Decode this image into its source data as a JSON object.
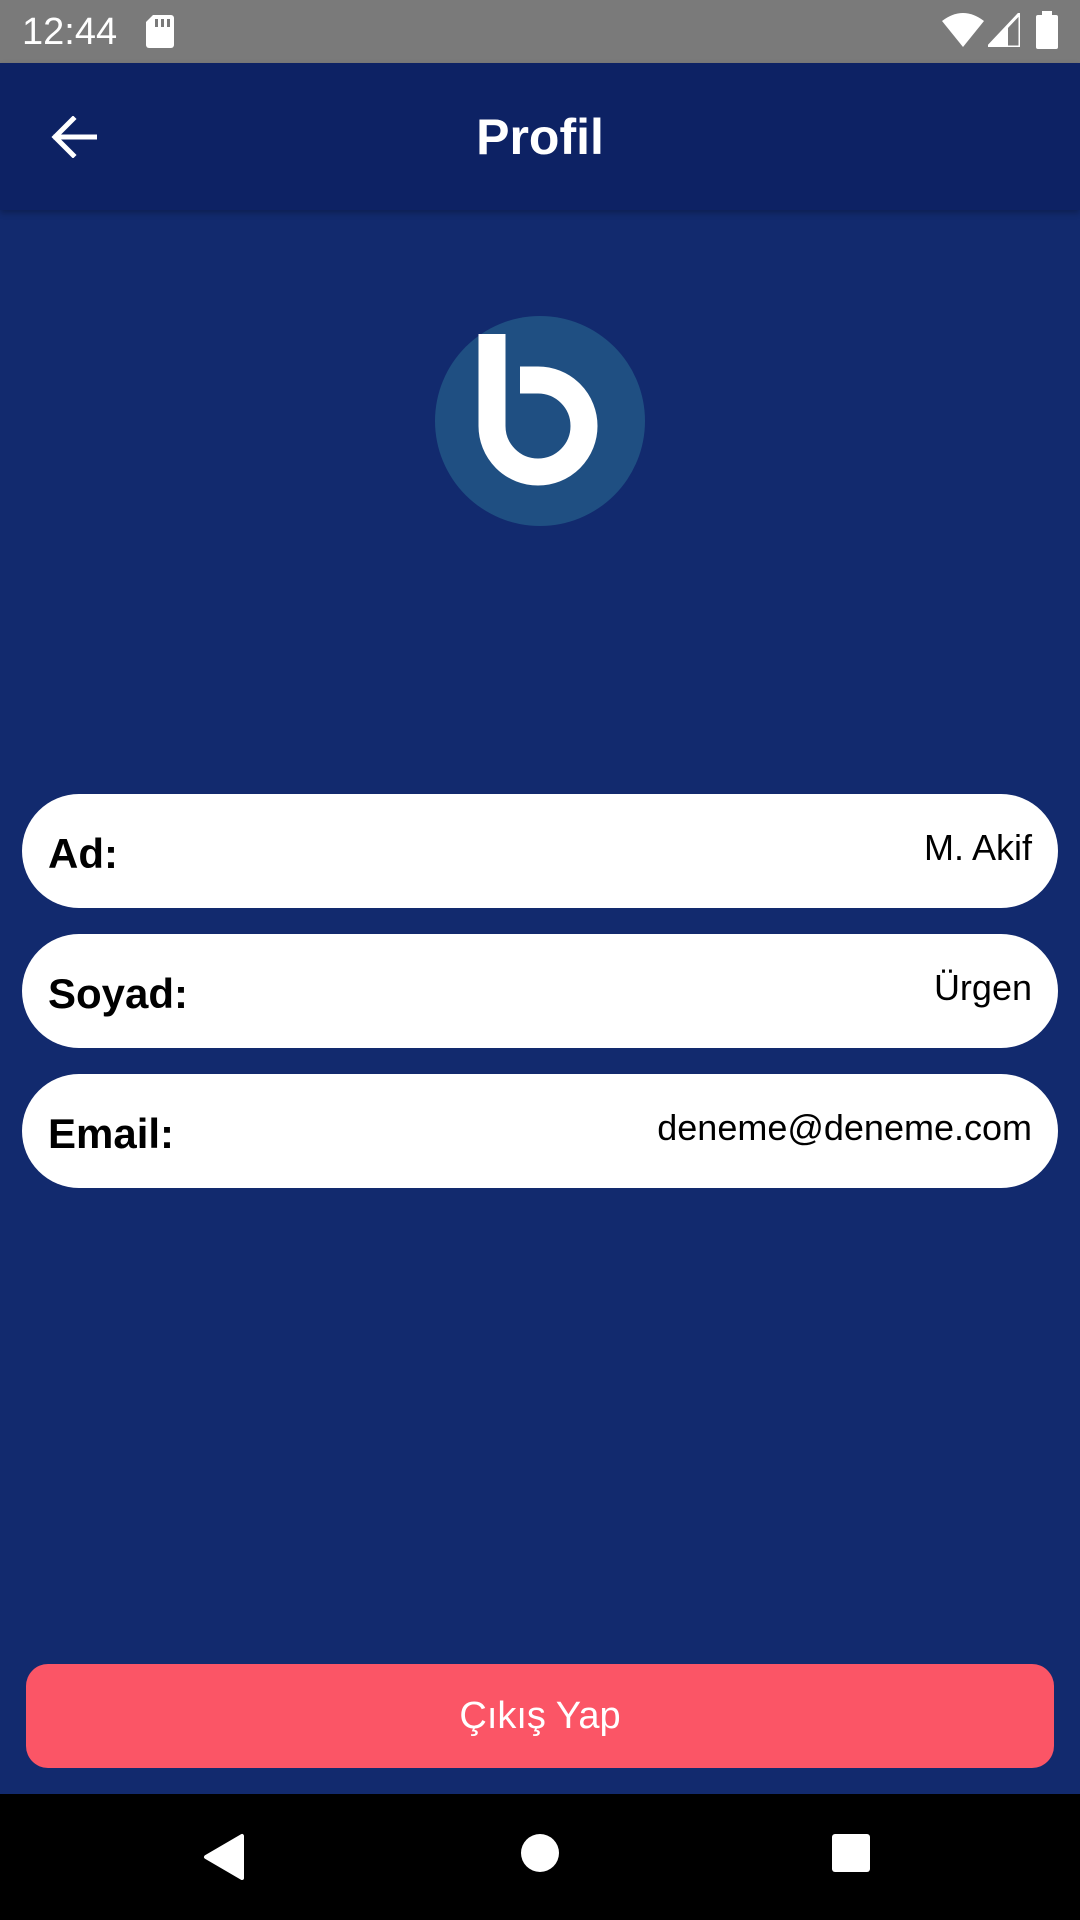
{
  "status_bar": {
    "time": "12:44",
    "icons": [
      "sd-card-icon",
      "wifi-icon",
      "signal-icon",
      "battery-icon"
    ]
  },
  "app_bar": {
    "title": "Profil",
    "back_icon": "arrow-left-icon"
  },
  "logo": {
    "icon": "brand-b-logo",
    "circle_color": "#1F4F82"
  },
  "profile": {
    "fields": [
      {
        "label": "Ad:",
        "value": "M. Akif"
      },
      {
        "label": "Soyad:",
        "value": "Ürgen"
      },
      {
        "label": "Email:",
        "value": "deneme@deneme.com"
      }
    ]
  },
  "actions": {
    "logout_label": "Çıkış Yap"
  },
  "nav_bar": {
    "icons": [
      "nav-back-icon",
      "nav-home-icon",
      "nav-recents-icon"
    ]
  },
  "colors": {
    "background": "#122A6E",
    "app_bar": "#0D2264",
    "logout_button": "#FB5566",
    "field_background": "#FFFFFF"
  }
}
